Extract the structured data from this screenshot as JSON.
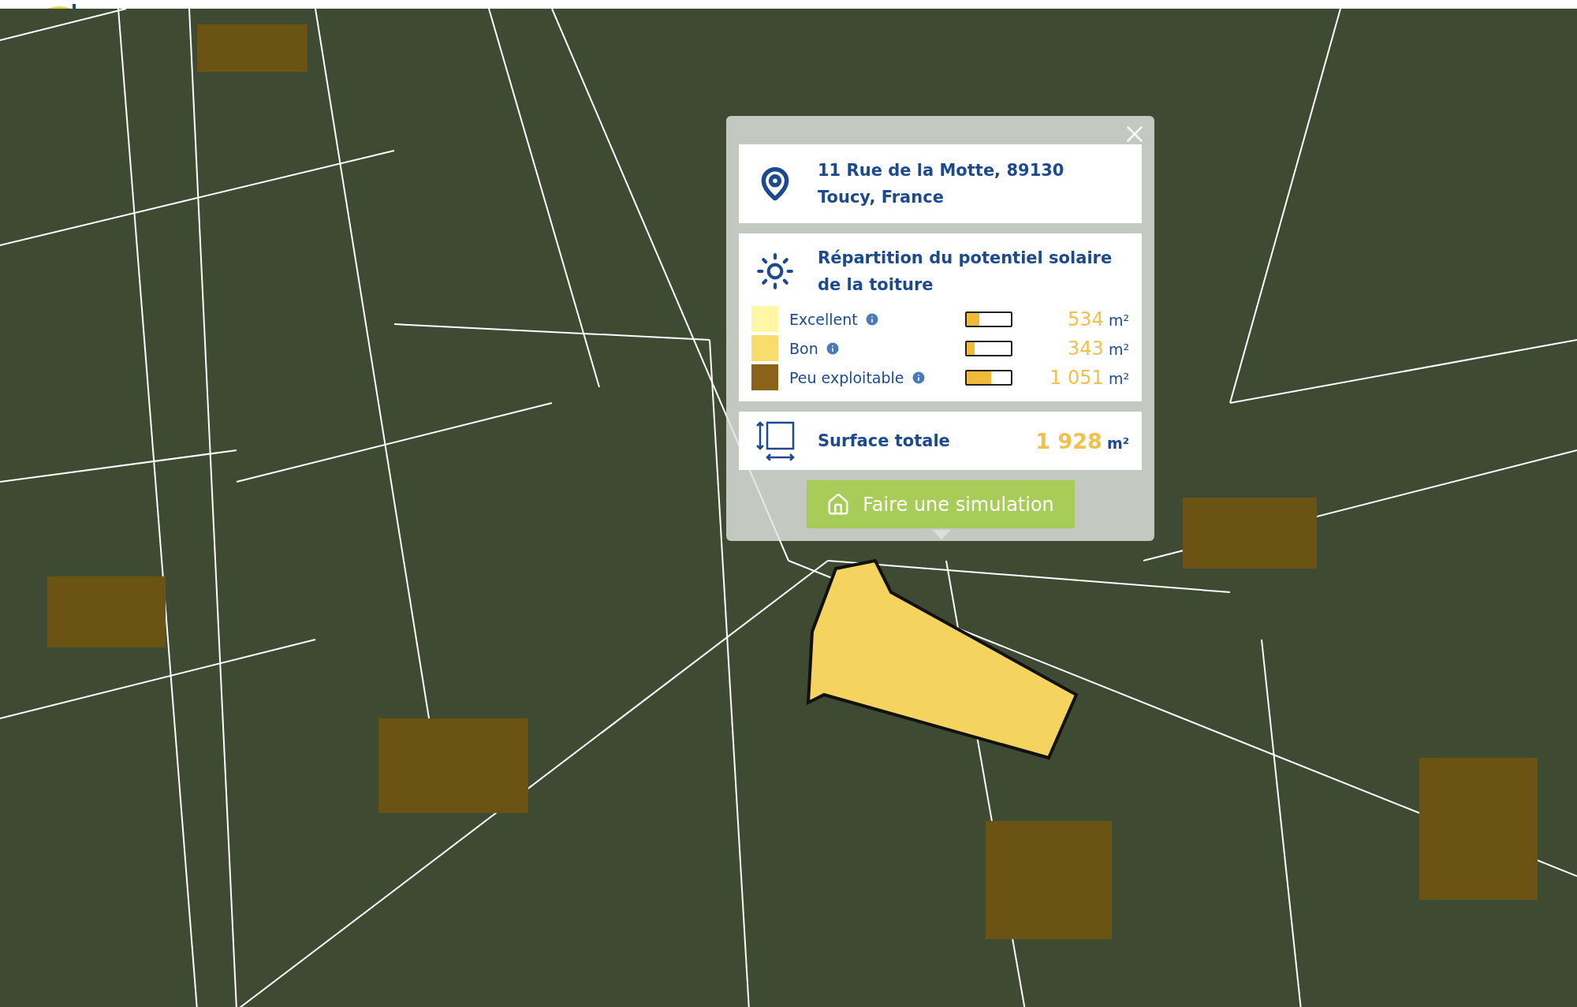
{
  "popup": {
    "address": {
      "lines": [
        "11 Rue de la Motte, 89130",
        "Toucy, France"
      ]
    },
    "solar": {
      "title": "Répartition du potentiel solaire de la toiture",
      "rows": [
        {
          "label": "Excellent",
          "color": "#fff7a6",
          "level": 0.28,
          "value": "534",
          "unit": "m²"
        },
        {
          "label": "Bon",
          "color": "#f8dc6c",
          "level": 0.18,
          "value": "343",
          "unit": "m²"
        },
        {
          "label": "Peu exploitable",
          "color": "#8a631a",
          "level": 0.55,
          "value": "1 051",
          "unit": "m²"
        }
      ]
    },
    "total": {
      "label": "Surface totale",
      "value": "1 928",
      "unit": "m²"
    },
    "button": {
      "label": "Faire une simulation"
    }
  }
}
